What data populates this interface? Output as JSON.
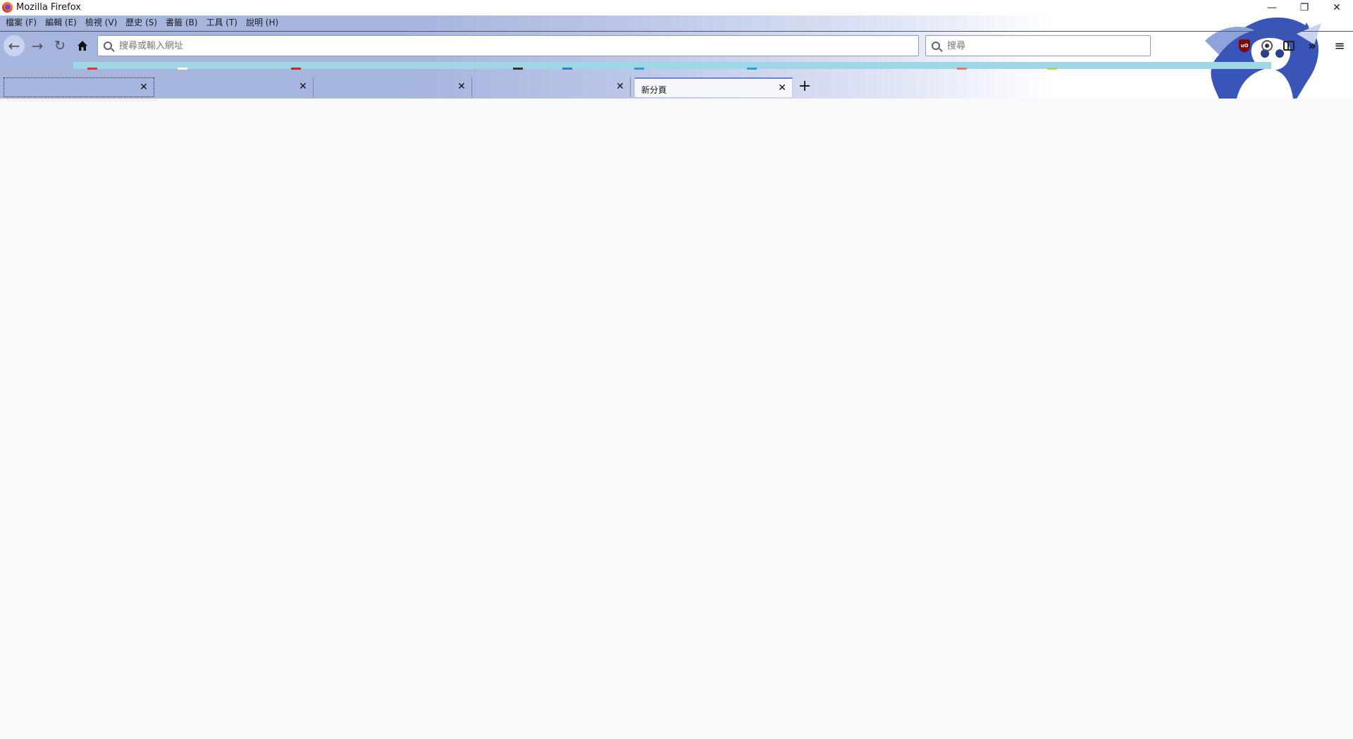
{
  "window": {
    "title": "Mozilla Firefox",
    "controls": {
      "minimize": "—",
      "restore": "❐",
      "close": "✕"
    }
  },
  "menubar": {
    "items": [
      "檔案 (F)",
      "編輯 (E)",
      "檢視 (V)",
      "歷史 (S)",
      "書籤 (B)",
      "工具 (T)",
      "說明 (H)"
    ]
  },
  "navbar": {
    "back_icon": "←",
    "forward_icon": "→",
    "reload_icon": "↻",
    "home_icon": "⌂",
    "url_placeholder": "搜尋或輸入網址",
    "search_placeholder": "搜尋",
    "ublock_label": "uO",
    "overflow_icon": "»",
    "menu_icon": "≡"
  },
  "tabs": [
    {
      "label": "",
      "close": "✕"
    },
    {
      "label": "",
      "close": "✕"
    },
    {
      "label": "",
      "close": "✕"
    },
    {
      "label": "",
      "close": "✕"
    },
    {
      "label": "新分頁",
      "close": "✕"
    }
  ],
  "new_tab_icon": "+",
  "colors": {
    "chrome_blue": "#a6b5de",
    "bookmarks_strip": "#9fd6e6",
    "active_tab": "#f7f8fc",
    "page_background": "#f9f9fb"
  }
}
